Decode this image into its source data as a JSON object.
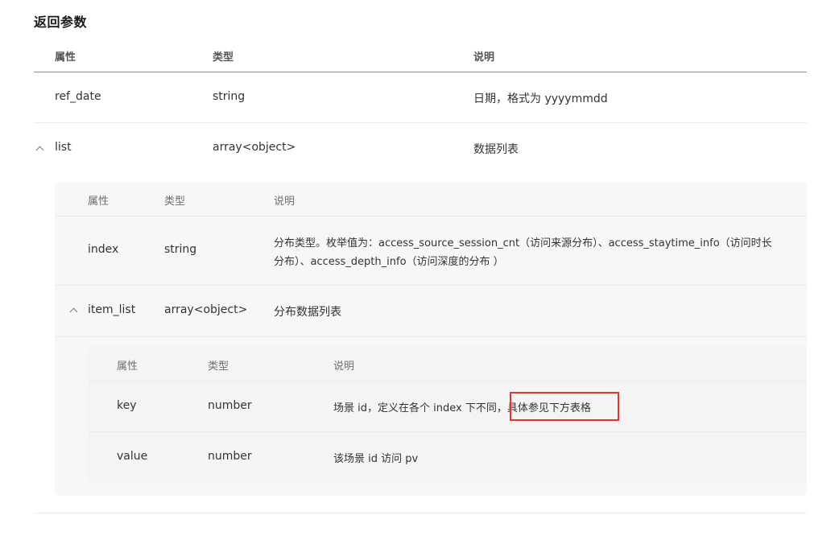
{
  "section_title": "返回参数",
  "outer_table": {
    "headers": {
      "attr": "属性",
      "type": "类型",
      "desc": "说明"
    },
    "rows": [
      {
        "name": "ref_date",
        "type": "string",
        "desc": "日期，格式为 yyyymmdd"
      },
      {
        "name": "list",
        "type": "array<object>",
        "desc": "数据列表",
        "expanded": true
      }
    ]
  },
  "list_table": {
    "headers": {
      "attr": "属性",
      "type": "类型",
      "desc": "说明"
    },
    "rows": [
      {
        "name": "index",
        "type": "string",
        "desc_line1": "分布类型。枚举值为：access_source_session_cnt（访问来源分布）、access_staytime_info（访问时长",
        "desc_line2": "分布）、access_depth_info（访问深度的分布 ）"
      },
      {
        "name": "item_list",
        "type": "array<object>",
        "desc": "分布数据列表",
        "expanded": true
      }
    ]
  },
  "item_list_table": {
    "headers": {
      "attr": "属性",
      "type": "类型",
      "desc": "说明"
    },
    "rows": [
      {
        "name": "key",
        "type": "number",
        "desc_prefix": "场景 id，定义在各个 index 下不同，",
        "desc_highlight": "具体参见下方表格"
      },
      {
        "name": "value",
        "type": "number",
        "desc": "该场景 id 访问 pv"
      }
    ]
  },
  "colors": {
    "highlight_border": "#e5322d",
    "panel_bg": "#f7f7f7",
    "header_rule": "#8c8c8c"
  }
}
